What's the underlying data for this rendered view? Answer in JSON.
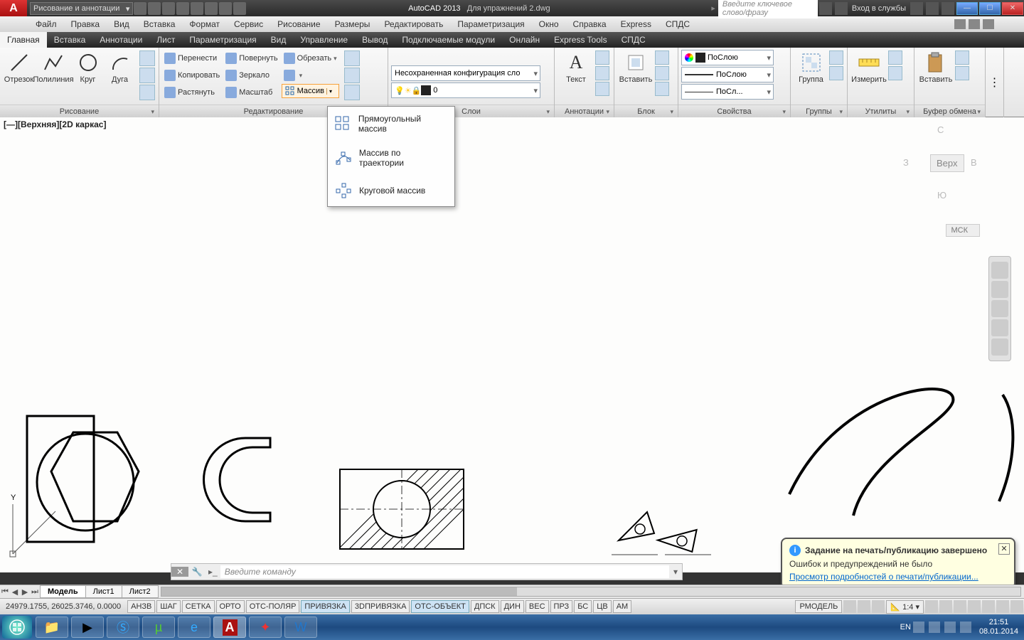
{
  "app": {
    "name": "AutoCAD 2013",
    "doc": "Для упражнений 2.dwg"
  },
  "qat": {
    "workspace": "Рисование и аннотации"
  },
  "search": {
    "placeholder": "Введите ключевое слово/фразу"
  },
  "signin": "Вход в службы",
  "win_btns": {
    "min": "—",
    "max": "☐",
    "close": "✕"
  },
  "menu": [
    "Файл",
    "Правка",
    "Вид",
    "Вставка",
    "Формат",
    "Сервис",
    "Рисование",
    "Размеры",
    "Редактировать",
    "Параметризация",
    "Окно",
    "Справка",
    "Express",
    "СПДС"
  ],
  "ribbon_tabs": [
    "Главная",
    "Вставка",
    "Аннотации",
    "Лист",
    "Параметризация",
    "Вид",
    "Управление",
    "Вывод",
    "Подключаемые модули",
    "Онлайн",
    "Express Tools",
    "СПДС"
  ],
  "panels": {
    "draw": {
      "title": "Рисование",
      "btns": {
        "line": "Отрезок",
        "polyline": "Полилиния",
        "circle": "Круг",
        "arc": "Дуга"
      }
    },
    "edit": {
      "title": "Редактирование",
      "btns": {
        "move": "Перенести",
        "rotate": "Повернуть",
        "trim": "Обрезать",
        "copy": "Копировать",
        "mirror": "Зеркало",
        "stretch": "Растянуть",
        "scale": "Масштаб",
        "array": "Массив"
      }
    },
    "layers": {
      "title": "Слои",
      "config_dd": "Несохраненная конфигурация сло",
      "current": "0"
    },
    "annot": {
      "title": "Аннотации",
      "text": "Текст"
    },
    "block": {
      "title": "Блок",
      "insert": "Вставить"
    },
    "props": {
      "title": "Свойства",
      "bylayer": "ПоСлою",
      "bylayer2": "ПоСлою",
      "bylayer3": "ПоСл..."
    },
    "groups": {
      "title": "Группы",
      "group": "Группа"
    },
    "utils": {
      "title": "Утилиты",
      "measure": "Измерить"
    },
    "clip": {
      "title": "Буфер обмена",
      "paste": "Вставить"
    }
  },
  "array_menu": [
    "Прямоугольный массив",
    "Массив по траектории",
    "Круговой массив"
  ],
  "viewport_label": "[—][Верхняя][2D каркас]",
  "viewcube": {
    "top": "Верх",
    "n": "С",
    "s": "Ю",
    "w": "З",
    "e": "В",
    "coord": "МСК"
  },
  "cmd_placeholder": "Введите команду",
  "notif": {
    "title": "Задание на печать/публикацию завершено",
    "body": "Ошибок и предупреждений не было",
    "link": "Просмотр подробностей о печати/публикации..."
  },
  "layout_tabs": [
    "Модель",
    "Лист1",
    "Лист2"
  ],
  "status": {
    "coords": "24979.1755, 26025.3746, 0.0000",
    "toggles": [
      "АНЗВ",
      "ШАГ",
      "СЕТКА",
      "ОРТО",
      "ОТС-ПОЛЯР",
      "ПРИВЯЗКА",
      "3DПРИВЯЗКА",
      "ОТС-ОБЪЕКТ",
      "ДПСК",
      "ДИН",
      "ВЕС",
      "ПРЗ",
      "БС",
      "ЦВ",
      "АМ"
    ],
    "toggles_on": [
      5,
      7
    ],
    "right": {
      "model": "РМОДЕЛЬ",
      "scale": "1:4"
    }
  },
  "tray": {
    "lang": "EN",
    "time": "21:51",
    "date": "08.01.2014"
  }
}
